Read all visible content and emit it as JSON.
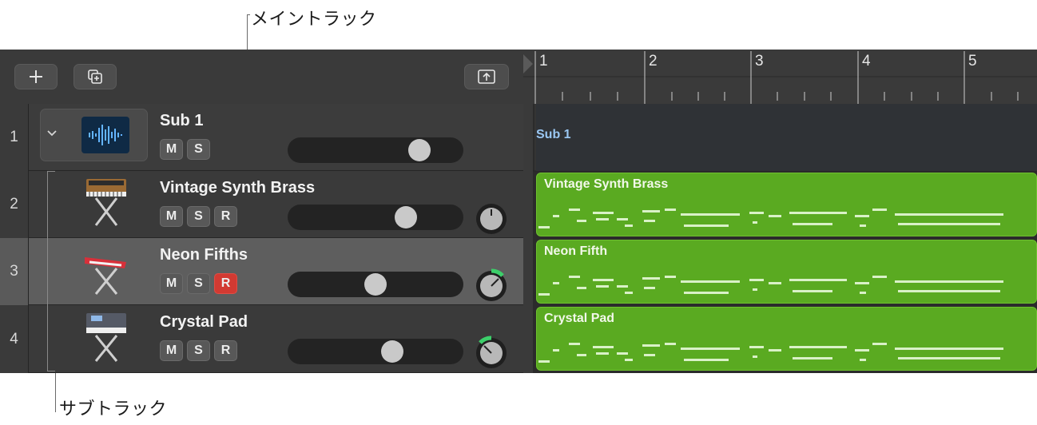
{
  "callouts": {
    "main_track": "メイントラック",
    "sub_tracks": "サブトラック"
  },
  "toolbar": {
    "add_icon": "plus-icon",
    "duplicate_icon": "duplicate-icon",
    "upload_icon": "upload-icon"
  },
  "ruler": {
    "bars": [
      "1",
      "2",
      "3",
      "4",
      "5"
    ]
  },
  "tracks": [
    {
      "number": "1",
      "name": "Sub 1",
      "buttons": [
        "M",
        "S"
      ],
      "fader_level": 0.79,
      "type": "summing-stack",
      "icon": "waveform-icon"
    },
    {
      "number": "2",
      "name": "Vintage Synth Brass",
      "buttons": [
        "M",
        "S",
        "R"
      ],
      "fader_level": 0.7,
      "pan": "center",
      "record_enabled": false,
      "icon": "analog-synth-icon"
    },
    {
      "number": "3",
      "name": "Neon Fifths",
      "buttons": [
        "M",
        "S",
        "R"
      ],
      "fader_level": 0.5,
      "pan": "right",
      "record_enabled": true,
      "selected": true,
      "icon": "red-keyboard-icon"
    },
    {
      "number": "4",
      "name": "Crystal Pad",
      "buttons": [
        "M",
        "S",
        "R"
      ],
      "fader_level": 0.61,
      "pan": "left",
      "record_enabled": false,
      "icon": "workstation-keyboard-icon"
    }
  ],
  "regions": [
    {
      "name": "Sub 1"
    },
    {
      "name": "Vintage Synth Brass"
    },
    {
      "name": "Neon Fifth"
    },
    {
      "name": "Crystal Pad"
    }
  ],
  "colors": {
    "region_green": "#5aaa21",
    "record_red": "#d23a32",
    "sub_label_blue": "#9ac7f2",
    "pan_indicator": "#3ccf6a"
  }
}
